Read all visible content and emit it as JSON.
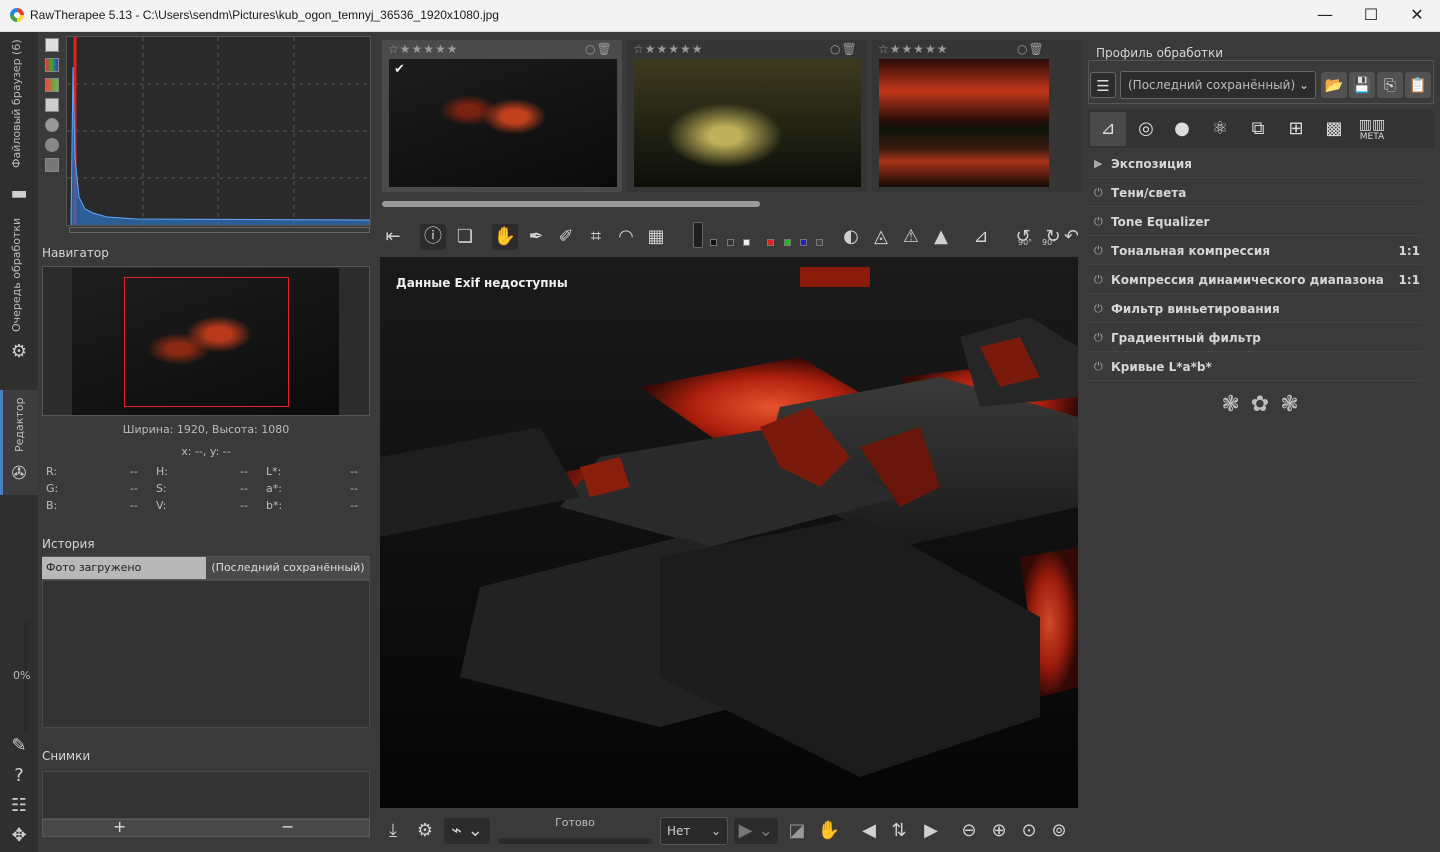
{
  "window": {
    "title": "RawTherapee 5.13 - C:\\Users\\sendm\\Pictures\\kub_ogon_temnyj_36536_1920x1080.jpg",
    "controls": {
      "minimize": "—",
      "maximize": "☐",
      "close": "✕"
    }
  },
  "vtabs": {
    "file_browser": "Файловый браузер (6)",
    "queue": "Очередь обработки",
    "editor": "Редактор",
    "queue_progress": "0%"
  },
  "left": {
    "navigator_title": "Навигатор",
    "size_text": "Ширина: 1920, Высота: 1080",
    "coords_text": "x: --, y: --",
    "color_values": [
      {
        "label": "R:",
        "value": "--"
      },
      {
        "label": "H:",
        "value": "--"
      },
      {
        "label": "L*:",
        "value": "--"
      },
      {
        "label": "G:",
        "value": "--"
      },
      {
        "label": "S:",
        "value": "--"
      },
      {
        "label": "a*:",
        "value": "--"
      },
      {
        "label": "B:",
        "value": "--"
      },
      {
        "label": "V:",
        "value": "--"
      },
      {
        "label": "b*:",
        "value": "--"
      }
    ],
    "history_title": "История",
    "history_col1": "Фото загружено",
    "history_col2": "(Последний сохранённый)",
    "snapshots_title": "Снимки",
    "snap_add": "+",
    "snap_remove": "−"
  },
  "filmstrip": {
    "thumbs": [
      {
        "stars": "☆★★★★★",
        "selected": true,
        "checked": "✔"
      },
      {
        "stars": "☆★★★★★",
        "selected": false
      },
      {
        "stars": "☆★★★★★",
        "selected": false
      }
    ]
  },
  "viewer": {
    "exif_text": "Данные Exif недоступны",
    "rotate_left_label": "90°",
    "rotate_right_label": "90°"
  },
  "bottom": {
    "status": "Готово",
    "combo_value": "Нет"
  },
  "right": {
    "profile_title": "Профиль обработки",
    "profile_value": "(Последний сохранённый)",
    "meta_label": "META",
    "tools": [
      {
        "icon": "▶",
        "label": "Экспозиция",
        "ratio": ""
      },
      {
        "icon": "⏻",
        "label": "Тени/света",
        "ratio": ""
      },
      {
        "icon": "⏻",
        "label": "Tone Equalizer",
        "ratio": ""
      },
      {
        "icon": "⏻",
        "label": "Тональная компрессия",
        "ratio": "1:1"
      },
      {
        "icon": "⏻",
        "label": "Компрессия динамического диапазона",
        "ratio": "1:1"
      },
      {
        "icon": "⏻",
        "label": "Фильтр виньетирования",
        "ratio": ""
      },
      {
        "icon": "⏻",
        "label": "Градиентный фильтр",
        "ratio": ""
      },
      {
        "icon": "⏻",
        "label": "Кривые L*a*b*",
        "ratio": ""
      }
    ]
  }
}
